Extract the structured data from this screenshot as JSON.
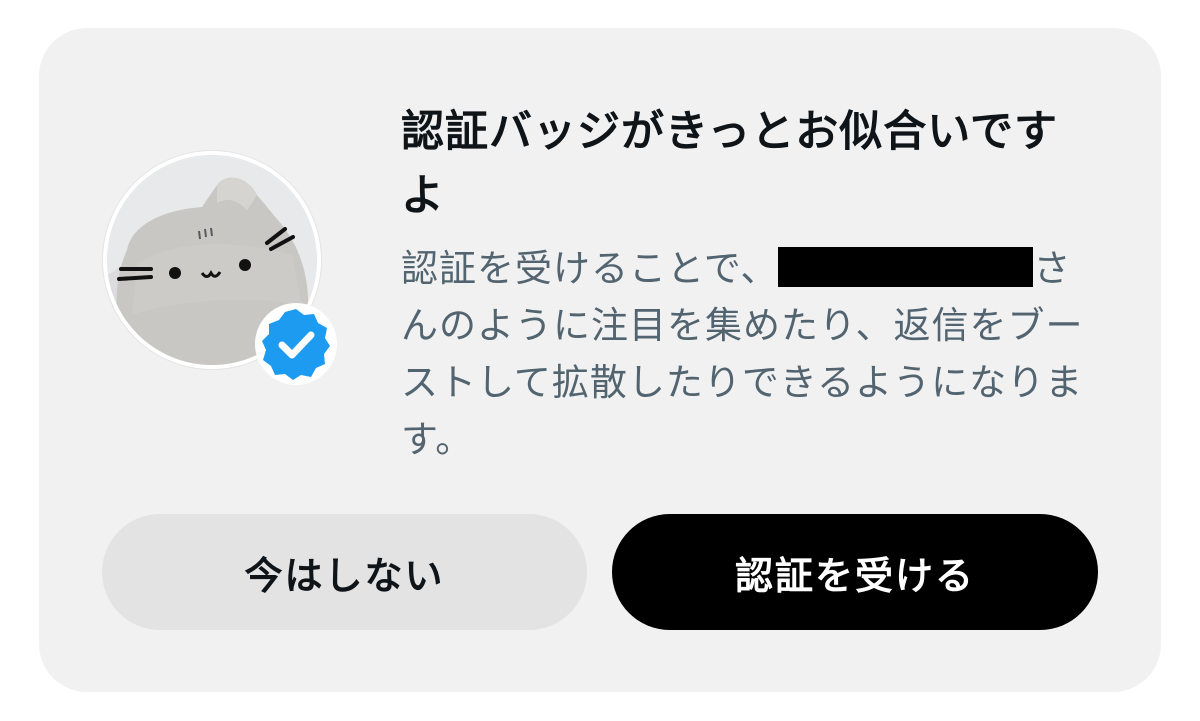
{
  "dialog": {
    "title": "認証バッジがきっとお似合いですよ",
    "body_prefix": "認証を受けることで、",
    "body_suffix": "さんのように注目を集めたり、返信をブーストして拡散したりできるようになります。",
    "dismiss_label": "今はしない",
    "confirm_label": "認証を受ける"
  },
  "colors": {
    "card_background": "#f1f1f1",
    "title_text": "#0f1419",
    "body_text": "#536471",
    "badge": "#1d9bf0",
    "primary_button": "#000000",
    "secondary_button": "#e3e3e3"
  },
  "icons": {
    "avatar": "cat-plush-avatar",
    "badge": "verified-badge-icon"
  }
}
